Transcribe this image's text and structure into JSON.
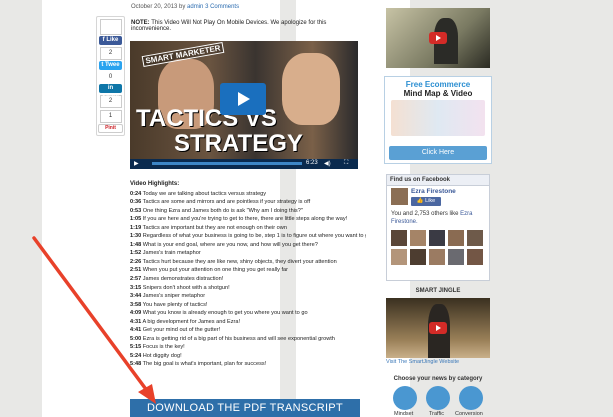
{
  "share": {
    "like_count": "",
    "fb_label": "Like",
    "fb_count": "2",
    "tweet_label": "Twee",
    "tweet_count": "0",
    "linkedin_label": "Share",
    "linkedin_count": "2",
    "gplus_count": "1",
    "pin_label": "Pinit"
  },
  "post": {
    "date": "October 20, 2013 by",
    "author": "admin",
    "comments": "3 Comments",
    "note_bold": "NOTE:",
    "note_text": "This Video Will Not Play On Mobile Devices. We apologize for this inconvenience."
  },
  "video": {
    "brand": "SMART MARKETER",
    "title_line1": "TACTICS VS",
    "title_line2": "STRATEGY",
    "time": "6:23"
  },
  "highlights": {
    "heading": "Video Highlights:",
    "items": [
      {
        "t": "0:24",
        "text": "Today we are talking about tactics versus strategy"
      },
      {
        "t": "0:36",
        "text": "Tactics are some and mirrors and are pointless if your strategy is off"
      },
      {
        "t": "0:53",
        "text": "One thing Ezra and James both do is ask \"Why am I doing this?\""
      },
      {
        "t": "1:05",
        "text": "If you are here and you're trying to get to there, there are little steps along the way!"
      },
      {
        "t": "1:19",
        "text": "Tactics are important but they are not enough on their own"
      },
      {
        "t": "1:30",
        "text": "Regardless of what your business is going to be, step 1 is to figure out where you want to go"
      },
      {
        "t": "1:48",
        "text": "What is your end goal, where are you now, and how will you get there?"
      },
      {
        "t": "1:52",
        "text": "James's train metaphor"
      },
      {
        "t": "2:26",
        "text": "Tactics hurt because they are like new, shiny objects, they divert your attention"
      },
      {
        "t": "2:51",
        "text": "When you put your attention on one thing you get really far"
      },
      {
        "t": "2:57",
        "text": "James demonstrates distraction!"
      },
      {
        "t": "3:15",
        "text": "Snipers don't shoot with a shotgun!"
      },
      {
        "t": "3:44",
        "text": "James's sniper metaphor"
      },
      {
        "t": "3:58",
        "text": "You have plenty of tactics!"
      },
      {
        "t": "4:09",
        "text": "What you know is already enough to get you where you want to go"
      },
      {
        "t": "4:31",
        "text": "A big development for James and Ezra!"
      },
      {
        "t": "4:41",
        "text": "Get your mind out of the gutter!"
      },
      {
        "t": "5:00",
        "text": "Ezra is getting rid of a big part of his business and will see exponential growth"
      },
      {
        "t": "5:15",
        "text": "Focus is the key!"
      },
      {
        "t": "5:24",
        "text": "Hot diggity dog!"
      },
      {
        "t": "5:48",
        "text": "The big goal is what's important, plan for success!"
      }
    ]
  },
  "download": {
    "label": "DOWNLOAD THE PDF TRANSCRIPT"
  },
  "sidebar": {
    "ecom_line1": "Free Ecommerce",
    "ecom_line2": "Mind Map & Video",
    "ecom_button": "Click Here",
    "fb_header": "Find us on Facebook",
    "fb_name": "Ezra Firestone",
    "fb_like": "Like",
    "fb_text": "You and 2,753 others like",
    "fb_text_link": "Ezra Firestone.",
    "sj_title": "SMART JINGLE",
    "sj_link": "Visit The SmartJingle Website",
    "cat_title": "Choose your news by category",
    "cats": [
      "Mindset",
      "Traffic",
      "Conversion"
    ]
  },
  "colors": {
    "accent": "#2e6fa9",
    "arrow": "#e8412a"
  }
}
